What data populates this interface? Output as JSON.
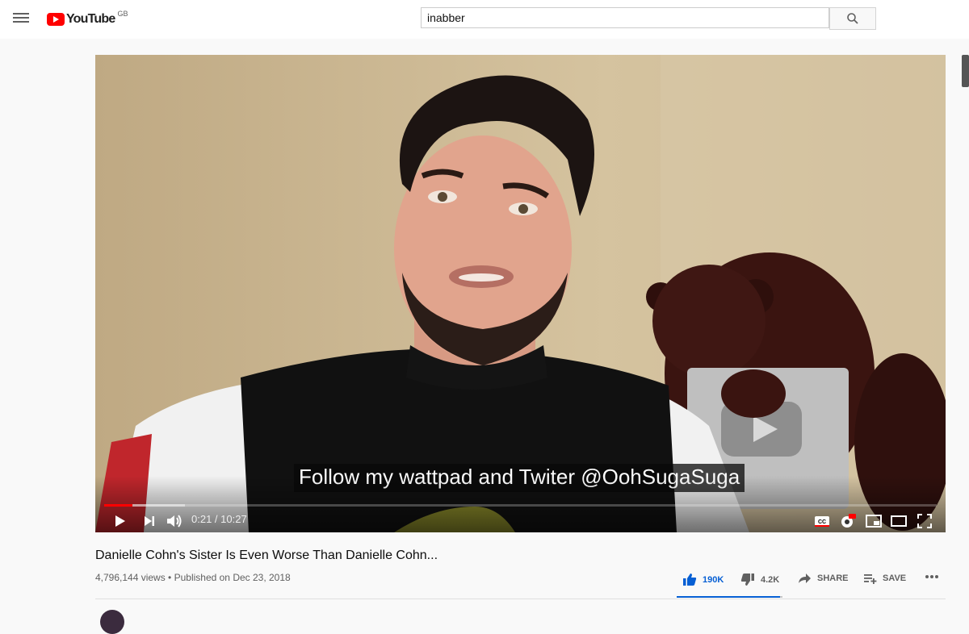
{
  "header": {
    "logo_text": "YouTube",
    "region": "GB",
    "search_value": "inabber",
    "icons": [
      "menu-icon",
      "youtube-logo",
      "search-icon"
    ]
  },
  "player": {
    "caption": "Follow my wattpad and Twiter @OohSugaSuga",
    "time_display": "0:21 / 10:27",
    "current_time": "0:21",
    "duration": "10:27",
    "progress_fraction": 0.0335,
    "icons": [
      "play-icon",
      "next-icon",
      "volume-icon",
      "cc-icon",
      "settings-hd-icon",
      "miniplayer-icon",
      "theater-icon",
      "fullscreen-icon"
    ]
  },
  "video": {
    "title": "Danielle Cohn's Sister Is Even Worse Than Danielle Cohn...",
    "meta": "4,796,144 views • Published on Dec 23, 2018",
    "likes": "190K",
    "dislikes": "4.2K",
    "share_label": "SHARE",
    "save_label": "SAVE",
    "like_ratio": 0.978
  },
  "colors": {
    "brand_red": "#ff0000",
    "like_blue": "#065fd4"
  }
}
